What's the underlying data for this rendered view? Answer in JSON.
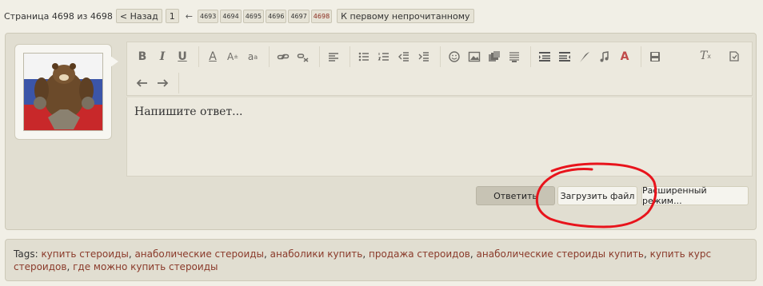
{
  "pagination": {
    "label": "Страница 4698 из 4698",
    "prev_label": "< Назад",
    "first_page": "1",
    "arrow": "←",
    "pages": [
      "4693",
      "4694",
      "4695",
      "4696",
      "4697",
      "4698"
    ],
    "current_page": "4698",
    "first_unread_label": "К первому непрочитанному"
  },
  "editor": {
    "placeholder": "Напишите ответ...",
    "toolbar_row1": [
      [
        "bold-icon",
        "italic-icon",
        "underline-icon"
      ],
      [
        "text-color-icon",
        "font-size-icon",
        "font-family-icon"
      ],
      [
        "link-icon",
        "unlink-icon"
      ],
      [
        "align-icon"
      ],
      [
        "bulleted-list-icon",
        "numbered-list-icon",
        "outdent-icon",
        "indent-icon"
      ],
      [
        "smiley-icon",
        "image-icon",
        "media-icon",
        "insert-more-icon"
      ],
      [
        "quote-icon",
        "code-icon",
        "feather-icon",
        "music-icon",
        "font-icon"
      ],
      [
        "save-draft-icon"
      ]
    ],
    "toolbar_right": [
      "remove-format-icon",
      "restore-draft-icon"
    ],
    "toolbar_row2": [
      "undo-icon",
      "redo-icon"
    ]
  },
  "actions": {
    "reply_label": "Ответить",
    "upload_label": "Загрузить файл",
    "advanced_label": "Расширенный режим..."
  },
  "tags": {
    "label": "Tags:",
    "items": [
      "купить стероиды",
      "анаболические стероиды",
      "анаболики купить",
      "продажа стероидов",
      "анаболические стероиды купить",
      "купить курс стероидов",
      "где можно купить стероиды"
    ]
  },
  "colors": {
    "background": "#f1efe6",
    "panel": "#e1ded1",
    "tag_link": "#8a3a2a",
    "annotation_red": "#e8141c"
  }
}
